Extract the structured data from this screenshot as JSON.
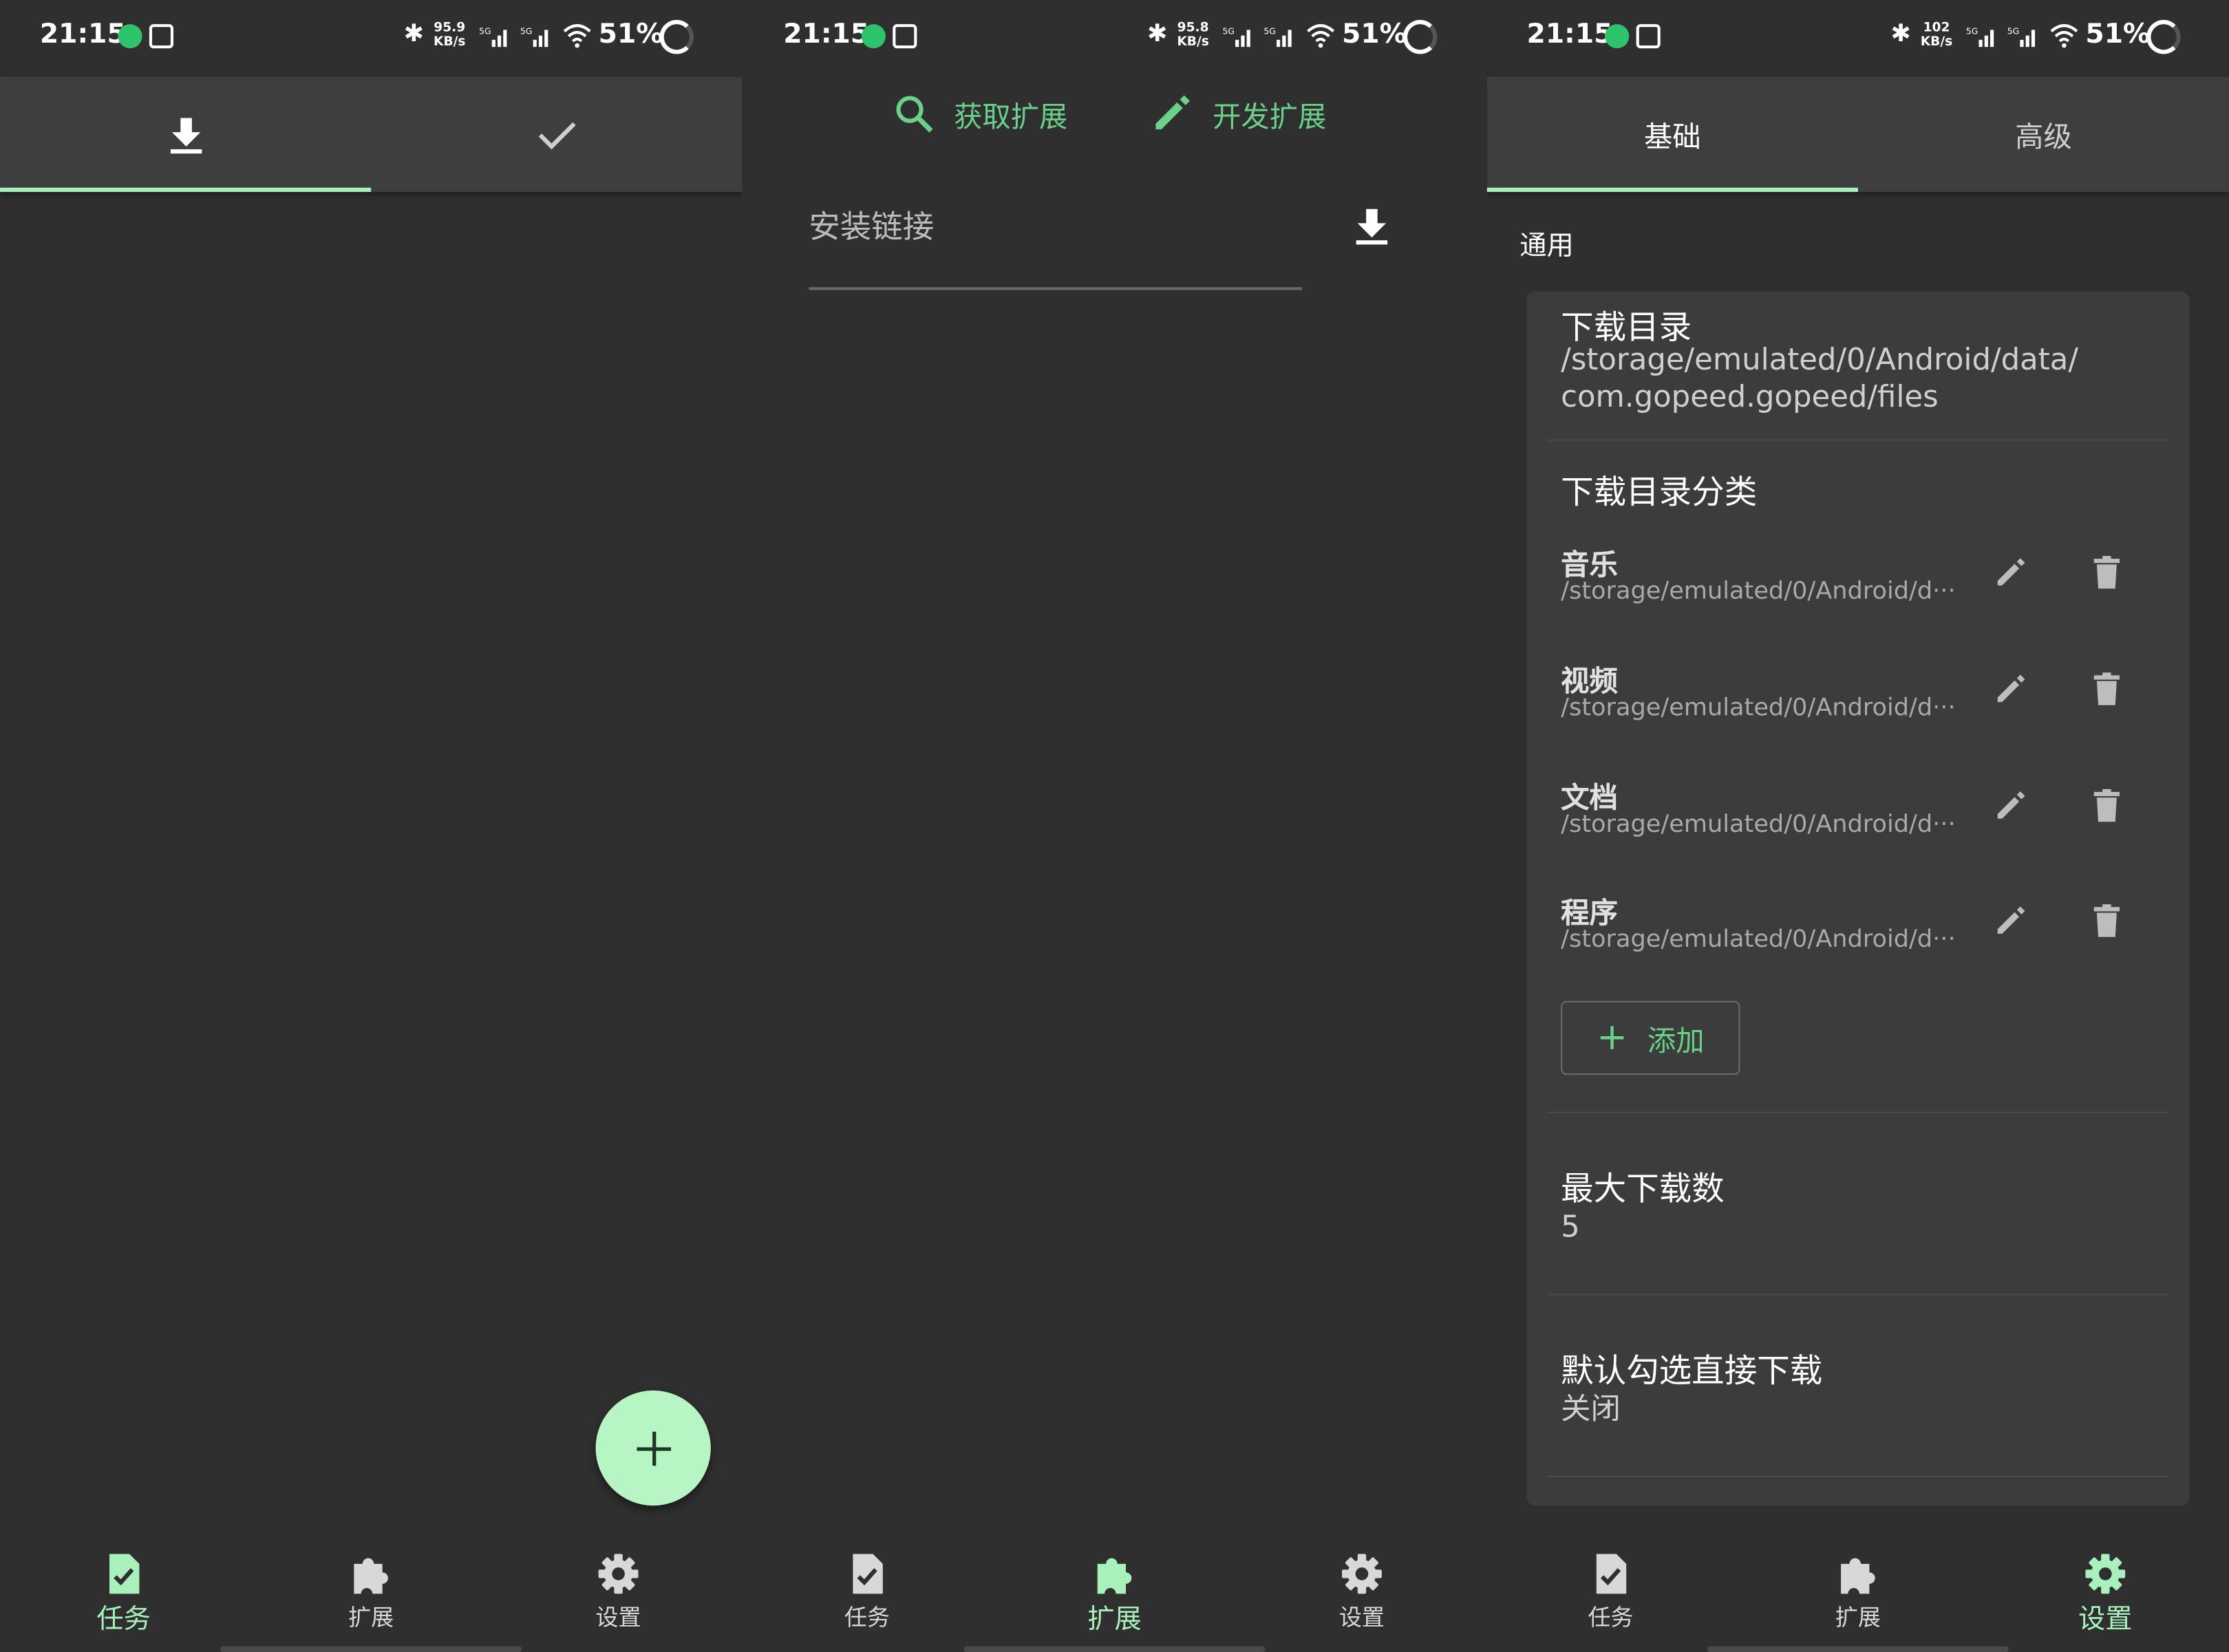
{
  "status_bar": {
    "time": "21:15",
    "battery": "51%",
    "speeds": [
      "95.9",
      "95.8",
      "102"
    ],
    "speed_unit": "KB/s",
    "network": "5G"
  },
  "panel_tasks": {
    "tabs": [
      {
        "icon": "download-icon"
      },
      {
        "icon": "check-icon"
      }
    ],
    "fab_icon": "plus-icon"
  },
  "panel_extensions": {
    "get_extension_label": "获取扩展",
    "dev_extension_label": "开发扩展",
    "install_link_label": "安装链接"
  },
  "panel_settings": {
    "tabs": [
      "基础",
      "高级"
    ],
    "section_general": "通用",
    "download_dir": {
      "title": "下载目录",
      "value_line1": "/storage/emulated/0/Android/data/",
      "value_line2": "com.gopeed.gopeed/files"
    },
    "categories": {
      "title": "下载目录分类",
      "items": [
        {
          "name": "音乐",
          "path": "/storage/emulated/0/Android/d···"
        },
        {
          "name": "视频",
          "path": "/storage/emulated/0/Android/d···"
        },
        {
          "name": "文档",
          "path": "/storage/emulated/0/Android/d···"
        },
        {
          "name": "程序",
          "path": "/storage/emulated/0/Android/d···"
        }
      ],
      "add_label": "添加"
    },
    "max_downloads": {
      "title": "最大下载数",
      "value": "5"
    },
    "default_direct": {
      "title": "默认勾选直接下载",
      "value": "关闭"
    }
  },
  "bottom_nav": {
    "items": [
      "任务",
      "扩展",
      "设置"
    ]
  },
  "colors": {
    "accent": "#a8f0bc",
    "accent_text": "#6bd08a",
    "background": "#2f2f2f",
    "app_bar": "#3e3e3e",
    "card": "#3c3c3c"
  }
}
